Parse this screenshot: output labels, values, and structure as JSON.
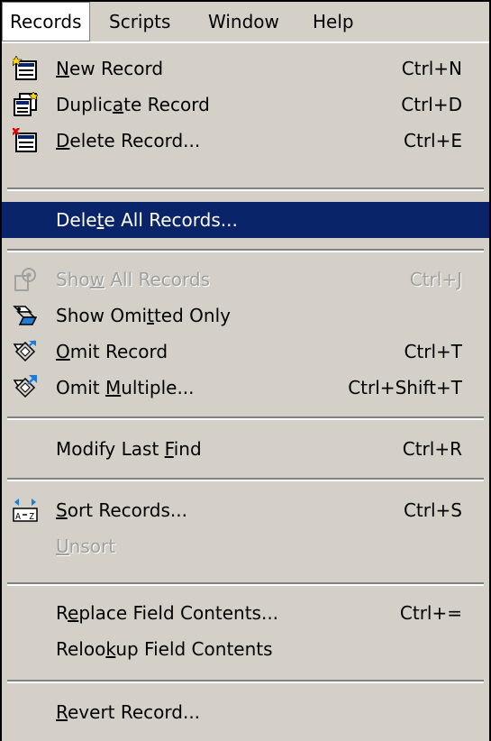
{
  "menubar": {
    "items": [
      {
        "label": "Records"
      },
      {
        "label": "Scripts"
      },
      {
        "label": "Window"
      },
      {
        "label": "Help"
      }
    ]
  },
  "menu": {
    "items": [
      {
        "pre": "",
        "ul": "N",
        "post": "ew Record",
        "shortcut": "Ctrl+N",
        "icon": "new-record-icon"
      },
      {
        "pre": "Duplic",
        "ul": "a",
        "post": "te Record",
        "shortcut": "Ctrl+D",
        "icon": "duplicate-record-icon"
      },
      {
        "pre": "",
        "ul": "D",
        "post": "elete Record...",
        "shortcut": "Ctrl+E",
        "icon": "delete-record-icon"
      },
      {
        "pre": "Dele",
        "ul": "t",
        "post": "e All Records...",
        "shortcut": ""
      },
      {
        "pre": "Sho",
        "ul": "w",
        "post": " All Records",
        "shortcut": "Ctrl+J",
        "icon": "show-all-records-icon"
      },
      {
        "pre": "Show Omi",
        "ul": "t",
        "post": "ted Only",
        "shortcut": "",
        "icon": "show-omitted-icon"
      },
      {
        "pre": "",
        "ul": "O",
        "post": "mit Record",
        "shortcut": "Ctrl+T",
        "icon": "omit-record-icon"
      },
      {
        "pre": "Omit ",
        "ul": "M",
        "post": "ultiple...",
        "shortcut": "Ctrl+Shift+T",
        "icon": "omit-multiple-icon"
      },
      {
        "pre": "Modify Last ",
        "ul": "F",
        "post": "ind",
        "shortcut": "Ctrl+R"
      },
      {
        "pre": "",
        "ul": "S",
        "post": "ort Records...",
        "shortcut": "Ctrl+S",
        "icon": "sort-records-icon"
      },
      {
        "pre": "",
        "ul": "U",
        "post": "nsort",
        "shortcut": ""
      },
      {
        "pre": "R",
        "ul": "e",
        "post": "place Field Contents...",
        "shortcut": "Ctrl+="
      },
      {
        "pre": "Relоo",
        "ul": "k",
        "post": "up Field Contents",
        "shortcut": ""
      },
      {
        "pre": "",
        "ul": "R",
        "post": "evert Record...",
        "shortcut": ""
      }
    ]
  },
  "colors": {
    "menu_bg": "#d4d0c8",
    "highlight_bg": "#0a246a",
    "highlight_text": "#ffffff",
    "disabled_text": "#a0a0a0"
  }
}
